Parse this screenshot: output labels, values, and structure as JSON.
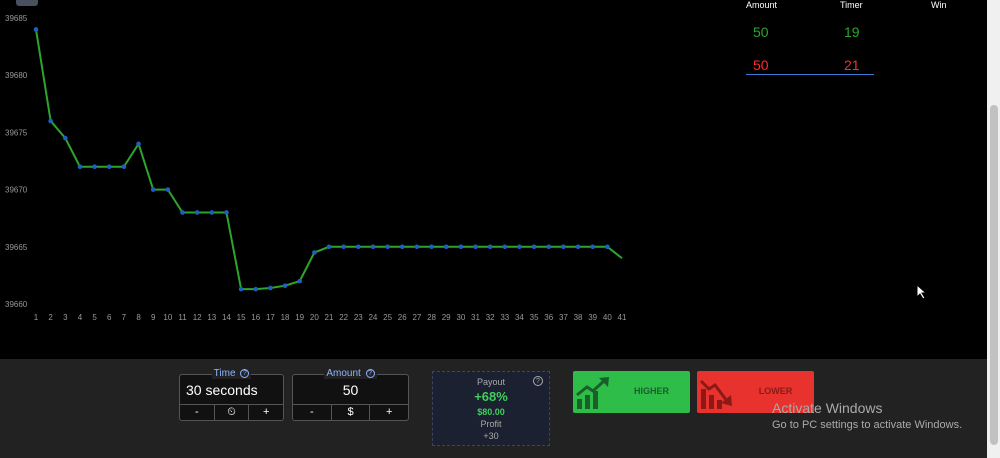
{
  "chart_data": {
    "type": "line",
    "x": [
      1,
      2,
      3,
      4,
      5,
      6,
      7,
      8,
      9,
      10,
      11,
      12,
      13,
      14,
      15,
      16,
      17,
      18,
      19,
      20,
      21,
      22,
      23,
      24,
      25,
      26,
      27,
      28,
      29,
      30,
      31,
      32,
      33,
      34,
      35,
      36,
      37,
      38,
      39,
      40,
      41
    ],
    "values": [
      39684,
      39676,
      39674.5,
      39672,
      39672,
      39672,
      39672,
      39674,
      39670,
      39670,
      39668,
      39668,
      39668,
      39668,
      39661.3,
      39661.3,
      39661.4,
      39661.6,
      39662,
      39664.5,
      39665,
      39665,
      39665,
      39665,
      39665,
      39665,
      39665,
      39665,
      39665,
      39665,
      39665,
      39665,
      39665,
      39665,
      39665,
      39665,
      39665,
      39665,
      39665,
      39665,
      39664
    ],
    "yticks": [
      "39685",
      "39680",
      "39675",
      "39670",
      "39665",
      "39660"
    ],
    "ylim": [
      39660,
      39685
    ],
    "line_color": "#2ca52c",
    "point_color": "#1f5fbf",
    "grid": false
  },
  "trades": {
    "headers": [
      "Amount",
      "Timer",
      "Win"
    ],
    "rows": [
      {
        "amount": "50",
        "timer": "19",
        "color": "#2ca52c"
      },
      {
        "amount": "50",
        "timer": "21",
        "color": "#ff2a2a"
      }
    ]
  },
  "controls": {
    "time": {
      "label": "Time",
      "value": "30 seconds",
      "btns": [
        "-",
        "⏲",
        "+"
      ]
    },
    "amount": {
      "label": "Amount",
      "value": "50",
      "btns": [
        "-",
        "$",
        "+"
      ]
    },
    "help_glyph": "?"
  },
  "payout": {
    "label": "Payout",
    "percent": "+68%",
    "amount": "$80.00",
    "profit_label": "Profit",
    "profit_value": "+30"
  },
  "buttons": {
    "higher": "HIGHER",
    "lower": "LOWER",
    "higher_icon": "trend-up-icon",
    "lower_icon": "trend-down-icon"
  },
  "watermark": {
    "title": "Activate Windows",
    "subtitle": "Go to PC settings to activate Windows."
  },
  "colors": {
    "green": "#2ca52c",
    "red": "#ff2a2a",
    "accent": "#8fb4ff"
  }
}
